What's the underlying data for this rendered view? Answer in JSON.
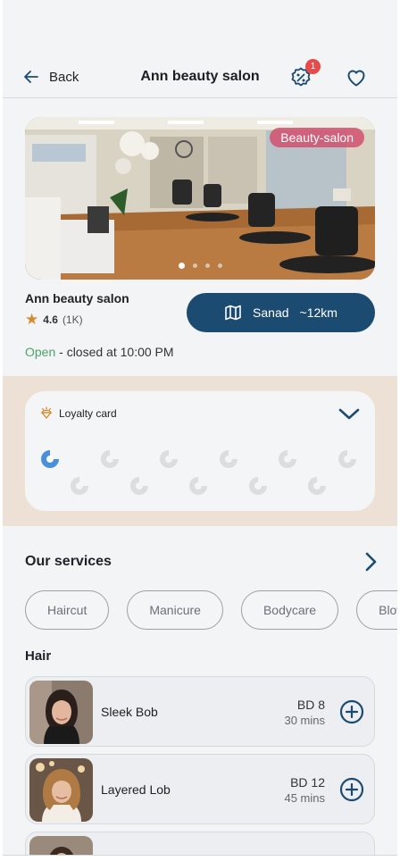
{
  "header": {
    "back_label": "Back",
    "title": "Ann beauty salon",
    "promo_badge_count": "1",
    "icons": [
      "arrow-left-icon",
      "discount-badge-icon",
      "heart-icon"
    ]
  },
  "hero": {
    "tag": "Beauty-salon",
    "slide_count": 4,
    "active_slide": 1
  },
  "salon": {
    "name": "Ann beauty salon",
    "rating": "4.6",
    "reviews": "(1K)",
    "status_open": "Open",
    "status_rest": " - closed at 10:00 PM"
  },
  "map_button": {
    "label": "Sanad",
    "distance": "~12km",
    "icon": "map-icon"
  },
  "loyalty": {
    "title": "Loyalty card",
    "stamps_total": 11,
    "stamps_filled": 1
  },
  "services": {
    "title": "Our services",
    "chips": [
      "Haircut",
      "Manicure",
      "Bodycare",
      "Blow dry"
    ],
    "section_title": "Hair",
    "items": [
      {
        "name": "Sleek Bob",
        "price": "BD 8",
        "duration": "30 mins"
      },
      {
        "name": "Layered Lob",
        "price": "BD 12",
        "duration": "45 mins"
      }
    ]
  },
  "colors": {
    "primary": "#1c4b72",
    "open_green": "#4ca36b",
    "loyalty_band": "#ede0d4",
    "badge_red": "#e84a4a",
    "tag_pink": "#d2506e"
  }
}
